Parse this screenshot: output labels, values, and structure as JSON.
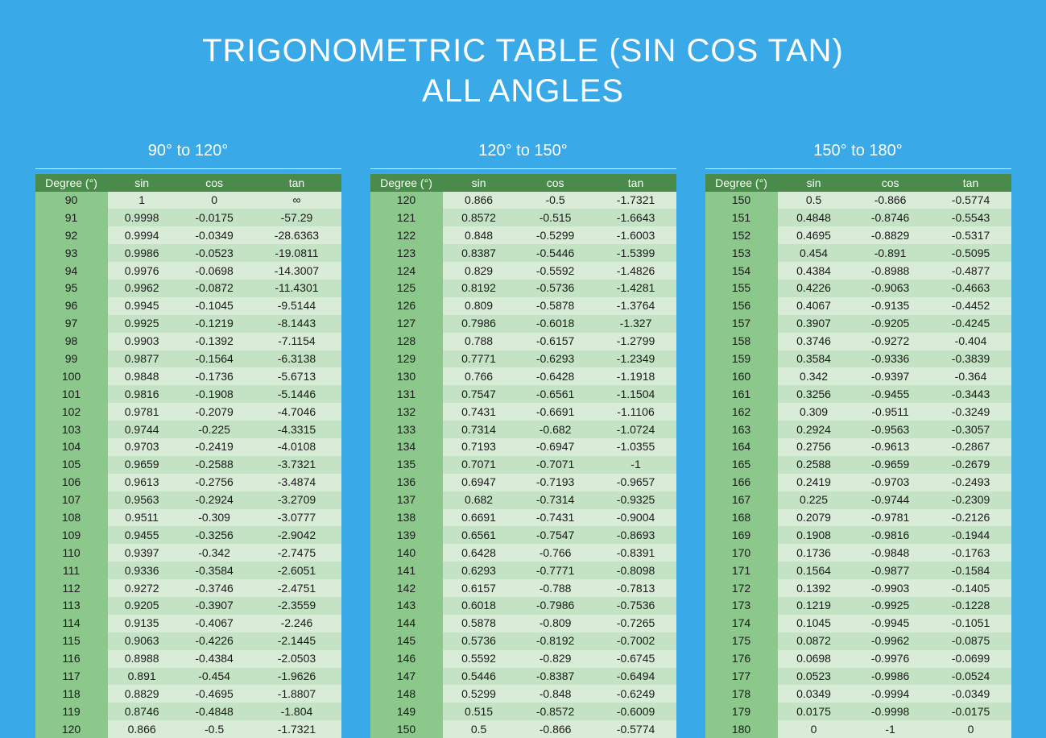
{
  "title_line1": "TRIGONOMETRIC TABLE (SIN COS TAN)",
  "title_line2": "ALL ANGLES",
  "columns": [
    "Degree (°)",
    "sin",
    "cos",
    "tan"
  ],
  "sections": [
    {
      "range": "90° to 120°",
      "rows": [
        [
          "90",
          "1",
          "0",
          "∞"
        ],
        [
          "91",
          "0.9998",
          "-0.0175",
          "-57.29"
        ],
        [
          "92",
          "0.9994",
          "-0.0349",
          "-28.6363"
        ],
        [
          "93",
          "0.9986",
          "-0.0523",
          "-19.0811"
        ],
        [
          "94",
          "0.9976",
          "-0.0698",
          "-14.3007"
        ],
        [
          "95",
          "0.9962",
          "-0.0872",
          "-11.4301"
        ],
        [
          "96",
          "0.9945",
          "-0.1045",
          "-9.5144"
        ],
        [
          "97",
          "0.9925",
          "-0.1219",
          "-8.1443"
        ],
        [
          "98",
          "0.9903",
          "-0.1392",
          "-7.1154"
        ],
        [
          "99",
          "0.9877",
          "-0.1564",
          "-6.3138"
        ],
        [
          "100",
          "0.9848",
          "-0.1736",
          "-5.6713"
        ],
        [
          "101",
          "0.9816",
          "-0.1908",
          "-5.1446"
        ],
        [
          "102",
          "0.9781",
          "-0.2079",
          "-4.7046"
        ],
        [
          "103",
          "0.9744",
          "-0.225",
          "-4.3315"
        ],
        [
          "104",
          "0.9703",
          "-0.2419",
          "-4.0108"
        ],
        [
          "105",
          "0.9659",
          "-0.2588",
          "-3.7321"
        ],
        [
          "106",
          "0.9613",
          "-0.2756",
          "-3.4874"
        ],
        [
          "107",
          "0.9563",
          "-0.2924",
          "-3.2709"
        ],
        [
          "108",
          "0.9511",
          "-0.309",
          "-3.0777"
        ],
        [
          "109",
          "0.9455",
          "-0.3256",
          "-2.9042"
        ],
        [
          "110",
          "0.9397",
          "-0.342",
          "-2.7475"
        ],
        [
          "111",
          "0.9336",
          "-0.3584",
          "-2.6051"
        ],
        [
          "112",
          "0.9272",
          "-0.3746",
          "-2.4751"
        ],
        [
          "113",
          "0.9205",
          "-0.3907",
          "-2.3559"
        ],
        [
          "114",
          "0.9135",
          "-0.4067",
          "-2.246"
        ],
        [
          "115",
          "0.9063",
          "-0.4226",
          "-2.1445"
        ],
        [
          "116",
          "0.8988",
          "-0.4384",
          "-2.0503"
        ],
        [
          "117",
          "0.891",
          "-0.454",
          "-1.9626"
        ],
        [
          "118",
          "0.8829",
          "-0.4695",
          "-1.8807"
        ],
        [
          "119",
          "0.8746",
          "-0.4848",
          "-1.804"
        ],
        [
          "120",
          "0.866",
          "-0.5",
          "-1.7321"
        ]
      ]
    },
    {
      "range": "120° to 150°",
      "rows": [
        [
          "120",
          "0.866",
          "-0.5",
          "-1.7321"
        ],
        [
          "121",
          "0.8572",
          "-0.515",
          "-1.6643"
        ],
        [
          "122",
          "0.848",
          "-0.5299",
          "-1.6003"
        ],
        [
          "123",
          "0.8387",
          "-0.5446",
          "-1.5399"
        ],
        [
          "124",
          "0.829",
          "-0.5592",
          "-1.4826"
        ],
        [
          "125",
          "0.8192",
          "-0.5736",
          "-1.4281"
        ],
        [
          "126",
          "0.809",
          "-0.5878",
          "-1.3764"
        ],
        [
          "127",
          "0.7986",
          "-0.6018",
          "-1.327"
        ],
        [
          "128",
          "0.788",
          "-0.6157",
          "-1.2799"
        ],
        [
          "129",
          "0.7771",
          "-0.6293",
          "-1.2349"
        ],
        [
          "130",
          "0.766",
          "-0.6428",
          "-1.1918"
        ],
        [
          "131",
          "0.7547",
          "-0.6561",
          "-1.1504"
        ],
        [
          "132",
          "0.7431",
          "-0.6691",
          "-1.1106"
        ],
        [
          "133",
          "0.7314",
          "-0.682",
          "-1.0724"
        ],
        [
          "134",
          "0.7193",
          "-0.6947",
          "-1.0355"
        ],
        [
          "135",
          "0.7071",
          "-0.7071",
          "-1"
        ],
        [
          "136",
          "0.6947",
          "-0.7193",
          "-0.9657"
        ],
        [
          "137",
          "0.682",
          "-0.7314",
          "-0.9325"
        ],
        [
          "138",
          "0.6691",
          "-0.7431",
          "-0.9004"
        ],
        [
          "139",
          "0.6561",
          "-0.7547",
          "-0.8693"
        ],
        [
          "140",
          "0.6428",
          "-0.766",
          "-0.8391"
        ],
        [
          "141",
          "0.6293",
          "-0.7771",
          "-0.8098"
        ],
        [
          "142",
          "0.6157",
          "-0.788",
          "-0.7813"
        ],
        [
          "143",
          "0.6018",
          "-0.7986",
          "-0.7536"
        ],
        [
          "144",
          "0.5878",
          "-0.809",
          "-0.7265"
        ],
        [
          "145",
          "0.5736",
          "-0.8192",
          "-0.7002"
        ],
        [
          "146",
          "0.5592",
          "-0.829",
          "-0.6745"
        ],
        [
          "147",
          "0.5446",
          "-0.8387",
          "-0.6494"
        ],
        [
          "148",
          "0.5299",
          "-0.848",
          "-0.6249"
        ],
        [
          "149",
          "0.515",
          "-0.8572",
          "-0.6009"
        ],
        [
          "150",
          "0.5",
          "-0.866",
          "-0.5774"
        ]
      ]
    },
    {
      "range": "150° to 180°",
      "rows": [
        [
          "150",
          "0.5",
          "-0.866",
          "-0.5774"
        ],
        [
          "151",
          "0.4848",
          "-0.8746",
          "-0.5543"
        ],
        [
          "152",
          "0.4695",
          "-0.8829",
          "-0.5317"
        ],
        [
          "153",
          "0.454",
          "-0.891",
          "-0.5095"
        ],
        [
          "154",
          "0.4384",
          "-0.8988",
          "-0.4877"
        ],
        [
          "155",
          "0.4226",
          "-0.9063",
          "-0.4663"
        ],
        [
          "156",
          "0.4067",
          "-0.9135",
          "-0.4452"
        ],
        [
          "157",
          "0.3907",
          "-0.9205",
          "-0.4245"
        ],
        [
          "158",
          "0.3746",
          "-0.9272",
          "-0.404"
        ],
        [
          "159",
          "0.3584",
          "-0.9336",
          "-0.3839"
        ],
        [
          "160",
          "0.342",
          "-0.9397",
          "-0.364"
        ],
        [
          "161",
          "0.3256",
          "-0.9455",
          "-0.3443"
        ],
        [
          "162",
          "0.309",
          "-0.9511",
          "-0.3249"
        ],
        [
          "163",
          "0.2924",
          "-0.9563",
          "-0.3057"
        ],
        [
          "164",
          "0.2756",
          "-0.9613",
          "-0.2867"
        ],
        [
          "165",
          "0.2588",
          "-0.9659",
          "-0.2679"
        ],
        [
          "166",
          "0.2419",
          "-0.9703",
          "-0.2493"
        ],
        [
          "167",
          "0.225",
          "-0.9744",
          "-0.2309"
        ],
        [
          "168",
          "0.2079",
          "-0.9781",
          "-0.2126"
        ],
        [
          "169",
          "0.1908",
          "-0.9816",
          "-0.1944"
        ],
        [
          "170",
          "0.1736",
          "-0.9848",
          "-0.1763"
        ],
        [
          "171",
          "0.1564",
          "-0.9877",
          "-0.1584"
        ],
        [
          "172",
          "0.1392",
          "-0.9903",
          "-0.1405"
        ],
        [
          "173",
          "0.1219",
          "-0.9925",
          "-0.1228"
        ],
        [
          "174",
          "0.1045",
          "-0.9945",
          "-0.1051"
        ],
        [
          "175",
          "0.0872",
          "-0.9962",
          "-0.0875"
        ],
        [
          "176",
          "0.0698",
          "-0.9976",
          "-0.0699"
        ],
        [
          "177",
          "0.0523",
          "-0.9986",
          "-0.0524"
        ],
        [
          "178",
          "0.0349",
          "-0.9994",
          "-0.0349"
        ],
        [
          "179",
          "0.0175",
          "-0.9998",
          "-0.0175"
        ],
        [
          "180",
          "0",
          "-1",
          "0"
        ]
      ]
    }
  ]
}
